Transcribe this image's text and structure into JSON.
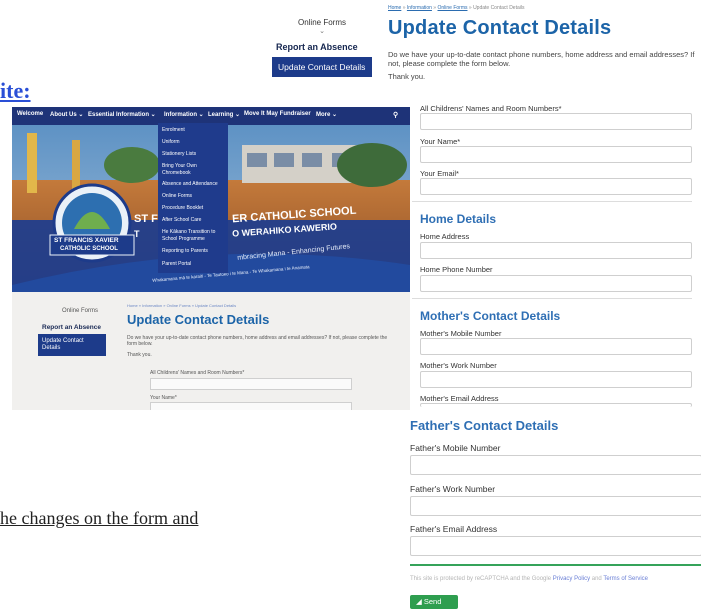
{
  "fragments": {
    "top_link": "ite:",
    "bottom_text": "he changes on the form and"
  },
  "top_nav": {
    "title": "Online Forms",
    "item_report": "Report an Absence",
    "item_update": "Update Contact Details"
  },
  "breadcrumb": {
    "home": "Home",
    "sep1": " » ",
    "information": "Information",
    "sep2": " » ",
    "online_forms": "Online Forms",
    "sep3": " » ",
    "current": "Update Contact Details"
  },
  "form": {
    "title": "Update Contact Details",
    "intro": "Do we have your up-to-date contact phone numbers, home address and email addresses? If not, please complete the form below.",
    "thanks": "Thank you.",
    "fields_top": {
      "childrens_names_label": "All Childrens' Names and Room Numbers*",
      "your_name_label": "Your Name*",
      "your_email_label": "Your Email*"
    },
    "home_details": {
      "heading": "Home Details",
      "address_label": "Home Address",
      "phone_label": "Home Phone Number"
    },
    "mother": {
      "heading": "Mother's Contact Details",
      "mobile_label": "Mother's Mobile Number",
      "work_label": "Mother's Work Number",
      "email_label": "Mother's Email Address"
    },
    "father": {
      "heading": "Father's Contact Details",
      "mobile_label": "Father's Mobile Number",
      "work_label": "Father's Work Number",
      "email_label": "Father's Email Address"
    },
    "recaptcha": {
      "text1": "This site is protected by reCAPTCHA and the Google ",
      "privacy": "Privacy Policy",
      "and": " and ",
      "terms": "Terms of Service"
    },
    "send_label": "Send"
  },
  "photo": {
    "nav": [
      "Welcome",
      "About Us ⌄",
      "Essential Information ⌄",
      "Information ⌄",
      "Learning ⌄",
      "Move It May Fundraiser",
      "More ⌄"
    ],
    "dropdown": [
      "Enrolment",
      "Uniform",
      "Stationery Lists",
      "Bring Your Own",
      "Chromebook",
      "Absence and Attendance",
      "Online Forms",
      "Procedure Booklet",
      "After School Care",
      "He Kākano Transition to",
      "School Programme",
      "Reporting to Parents",
      "Parent Portal"
    ],
    "school_sign": "ST FRANCIS XAVIER",
    "school_sign2": "CATHOLIC SCHOOL",
    "hero_title_1": "ST F",
    "hero_title_2": "ER CATHOLIC SCHOOL",
    "hero_sub_1": "T",
    "hero_sub_2": "O WERAHIKO KAWERIO",
    "hero_motto": "mbracing Mana - Enhancing Futures",
    "hero_maori": "Whakamana mā te karaiti - Te Tautoko i te Mana - Te Whakamana i te Anamata",
    "lower": {
      "nav_title": "Online Forms",
      "report": "Report an Absence",
      "update": "Update Contact Details",
      "crumbs": "Home » Information » Online Forms » Update Contact Details",
      "title": "Update Contact Details",
      "intro": "Do we have your up-to-date contact phone numbers, home address and email addresses? If not, please complete the form below.",
      "thanks": "Thank you.",
      "field1": "All Childrens' Names and Room Numbers*",
      "field2": "Your Name*"
    }
  },
  "colors": {
    "brand_blue": "#1d3b8a",
    "heading_blue": "#1c64a8",
    "section_blue": "#2f6fb4",
    "send_green": "#2e9e4f"
  }
}
